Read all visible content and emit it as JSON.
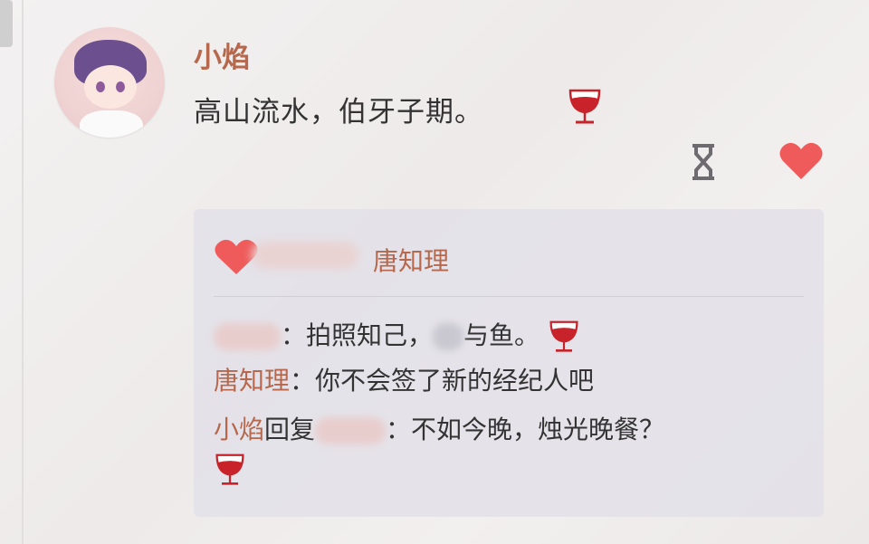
{
  "post": {
    "username": "小焰",
    "text": "高山流水，伯牙子期。"
  },
  "icons": {
    "wine": "wine-glass-icon",
    "hourglass": "hourglass-icon",
    "like": "heart-icon",
    "accent": "#b7674b",
    "heart_color": "#ef5b5b",
    "wine_color": "#c8232b"
  },
  "reply_card": {
    "likers_visible_name": "唐知理",
    "comments": [
      {
        "text_a": "：拍照知己，",
        "text_b": "与鱼。"
      },
      {
        "name": "唐知理",
        "text": "：你不会签了新的经纪人吧"
      },
      {
        "name": "小焰",
        "reply_word": "回复",
        "text": "：不如今晚，烛光晚餐？"
      }
    ]
  }
}
